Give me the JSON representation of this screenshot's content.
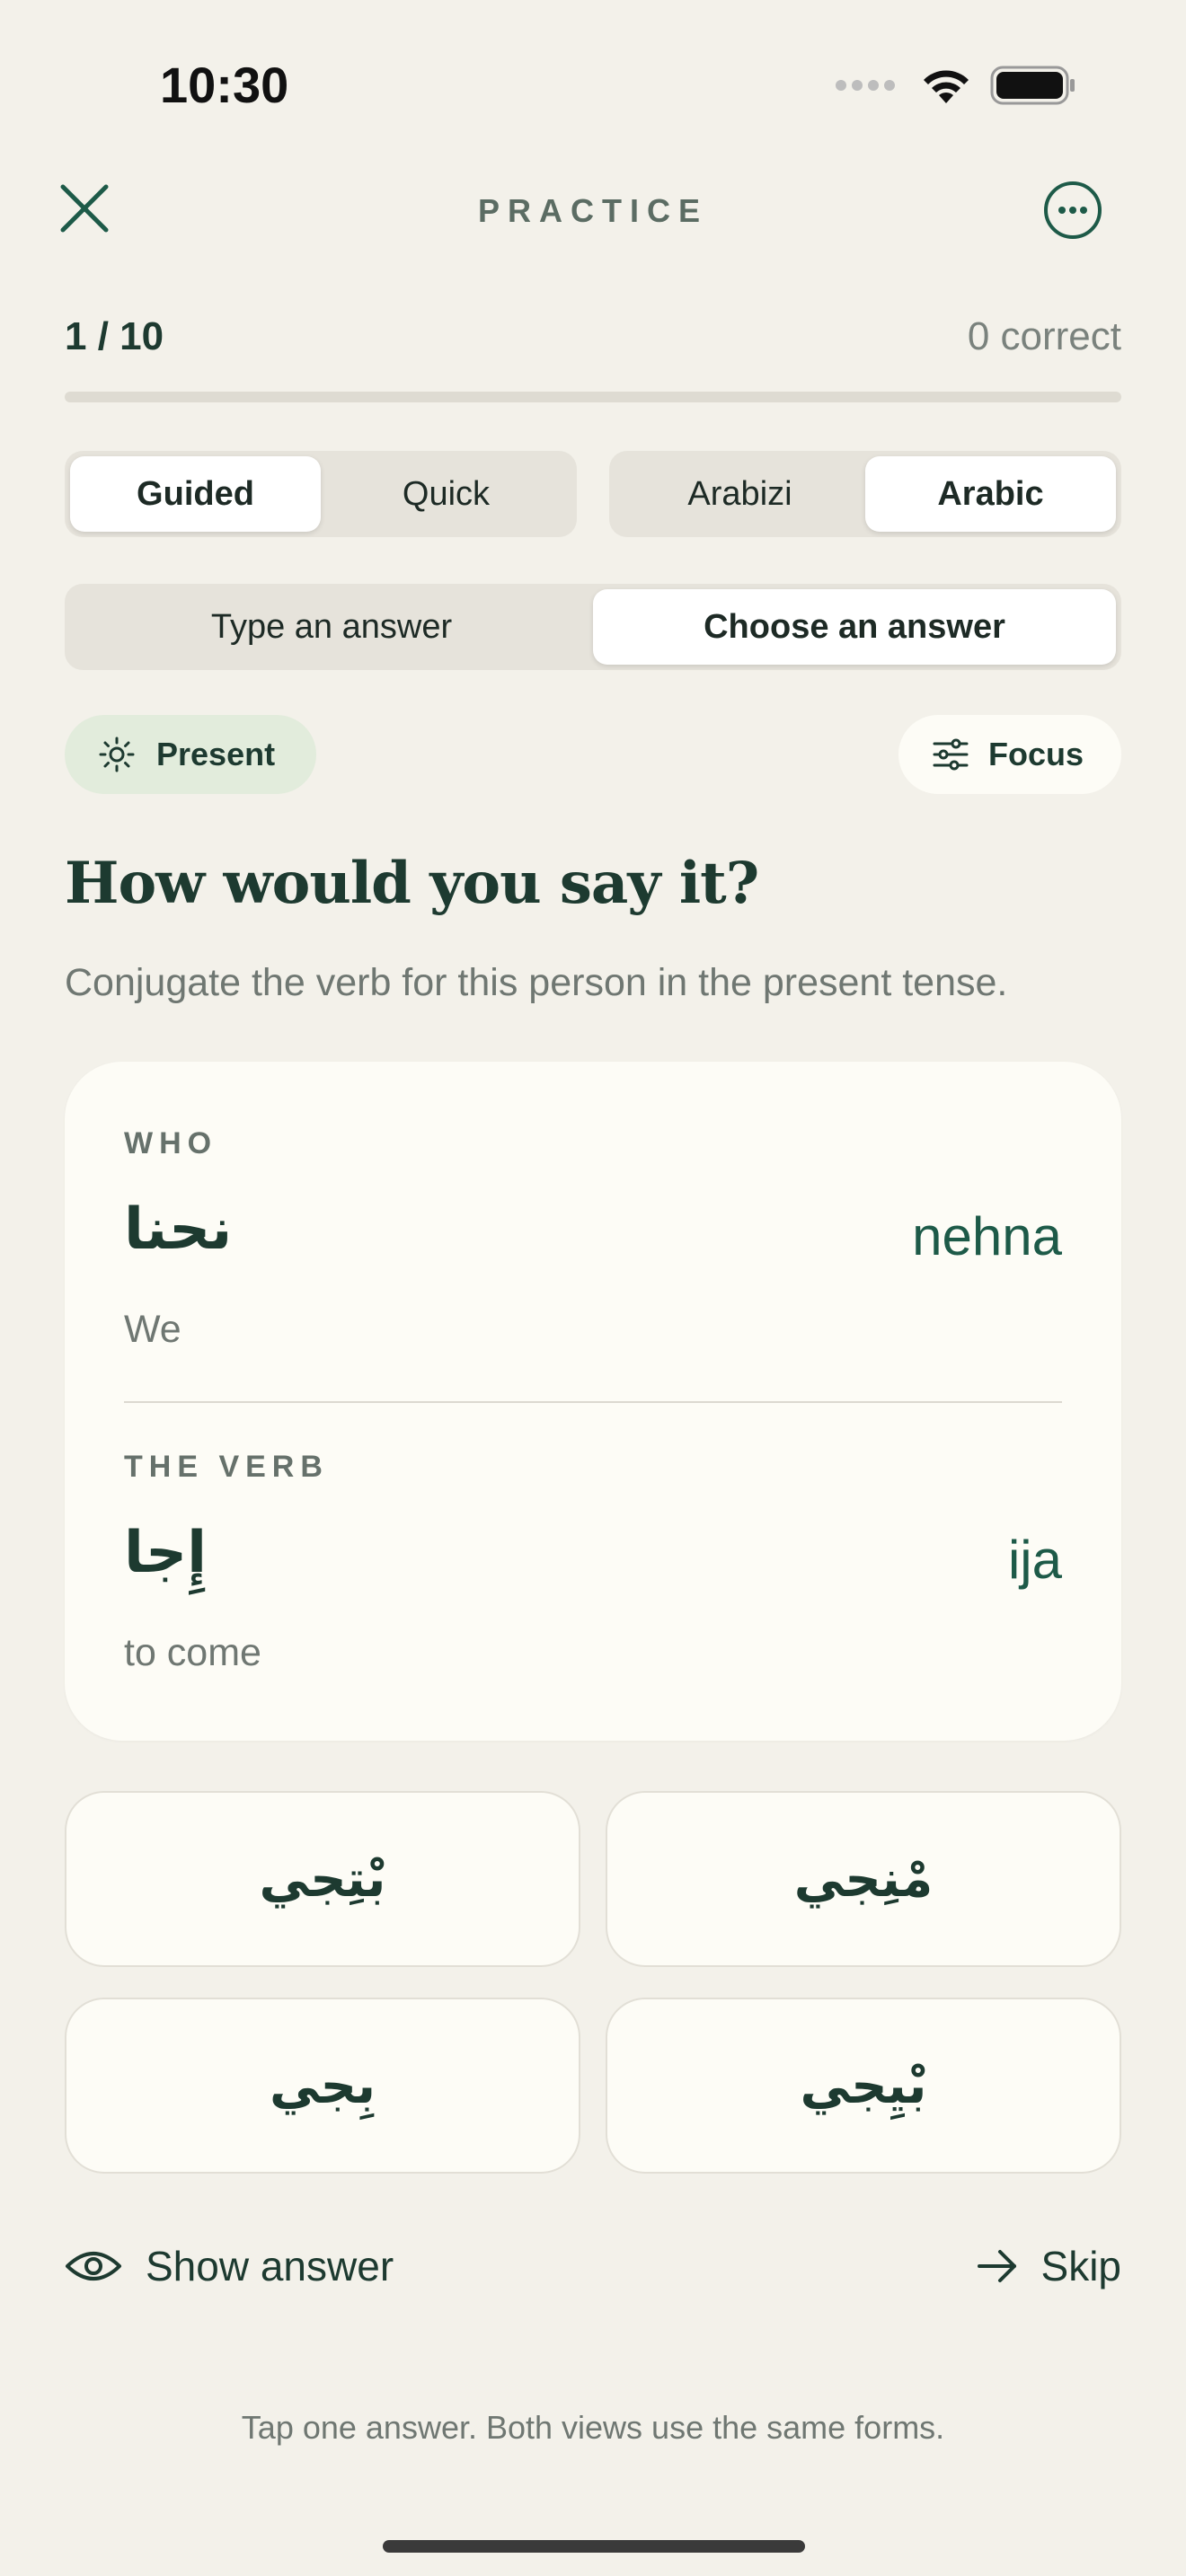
{
  "status_bar": {
    "time": "10:30"
  },
  "header": {
    "title": "PRACTICE"
  },
  "progress": {
    "label": "1 / 10",
    "correct": "0 correct",
    "fraction": 0.0
  },
  "mode_toggle": {
    "options": [
      "Guided",
      "Quick"
    ],
    "selected": "Guided"
  },
  "script_toggle": {
    "options": [
      "Arabizi",
      "Arabic"
    ],
    "selected": "Arabic"
  },
  "answer_toggle": {
    "options": [
      "Type an answer",
      "Choose an answer"
    ],
    "selected": "Choose an answer"
  },
  "tense_chip": {
    "label": "Present"
  },
  "focus_chip": {
    "label": "Focus"
  },
  "question": {
    "title": "How would you say it?",
    "instruction": "Conjugate the verb for this person in the present tense."
  },
  "card": {
    "who": {
      "label": "WHO",
      "arabic": "نحنا",
      "latin": "nehna",
      "meaning": "We"
    },
    "verb": {
      "label": "THE VERB",
      "arabic": "إِجا",
      "latin": "ija",
      "meaning": "to come"
    }
  },
  "answers": [
    "بْتِجي",
    "مْنِجي",
    "بِجي",
    "بْيِجي"
  ],
  "actions": {
    "show_answer": "Show answer",
    "skip": "Skip"
  },
  "footer": {
    "note": "Tap one answer. Both views use the same forms."
  },
  "colors": {
    "accent": "#1d5a48",
    "background": "#f3f1ea",
    "card": "#fdfcf6",
    "chip_present": "#e2ecdc"
  }
}
